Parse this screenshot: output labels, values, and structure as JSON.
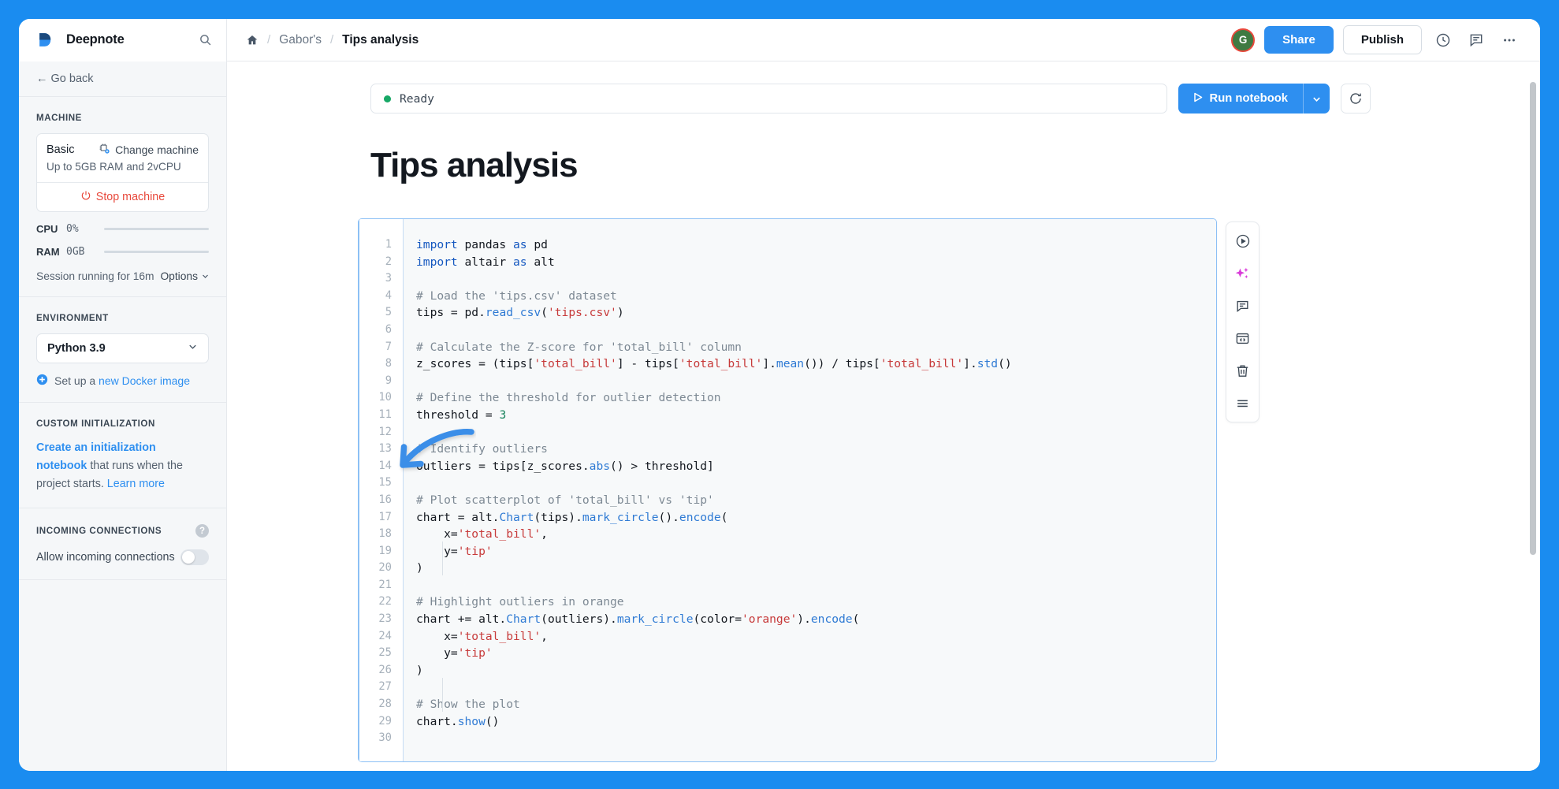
{
  "brand": {
    "name": "Deepnote",
    "logo_icon": "deepnote-logo",
    "search_icon": "search-icon"
  },
  "breadcrumb": {
    "home_icon": "home-icon",
    "sep": "/",
    "workspace": "Gabor's",
    "current": "Tips analysis"
  },
  "topbar_actions": {
    "avatar_initial": "G",
    "share_label": "Share",
    "publish_label": "Publish",
    "history_icon": "clock-history-icon",
    "comments_icon": "comment-icon",
    "more_icon": "more-horizontal-icon"
  },
  "sidebar": {
    "go_back": "← Go back",
    "machine": {
      "heading": "MACHINE",
      "name": "Basic",
      "change_label": "Change machine",
      "change_icon": "machine-chip-icon",
      "description": "Up to 5GB RAM and 2vCPU",
      "stop_label": "Stop machine",
      "stop_icon": "power-icon",
      "cpu_label": "CPU",
      "cpu_value": "0%",
      "ram_label": "RAM",
      "ram_value": "0GB",
      "session_text": "Session running for 16m",
      "options_label": "Options",
      "options_icon": "chevron-down-icon"
    },
    "environment": {
      "heading": "ENVIRONMENT",
      "selected": "Python 3.9",
      "chevron_icon": "chevron-down-icon",
      "docker_prefix": "Set up a ",
      "docker_link": "new Docker image",
      "plus_icon": "plus-circle-icon"
    },
    "custom_init": {
      "heading": "CUSTOM INITIALIZATION",
      "link_main": "Create an initialization notebook",
      "text_middle": " that runs when the project starts. ",
      "link_more": "Learn more"
    },
    "incoming": {
      "heading": "INCOMING CONNECTIONS",
      "help_icon": "help-circle-icon",
      "help_glyph": "?",
      "toggle_label": "Allow incoming connections",
      "toggle_state": "off"
    }
  },
  "main": {
    "status": {
      "text": "Ready",
      "dot_color": "#17a866"
    },
    "run": {
      "label": "Run notebook",
      "play_icon": "play-triangle-icon",
      "caret_icon": "chevron-down-icon",
      "refresh_icon": "refresh-icon"
    },
    "notebook_title": "Tips analysis",
    "cell": {
      "line_numbers": [
        "1",
        "2",
        "3",
        "4",
        "5",
        "6",
        "7",
        "8",
        "9",
        "10",
        "11",
        "12",
        "13",
        "14",
        "15",
        "16",
        "17",
        "18",
        "19",
        "20",
        "21",
        "22",
        "23",
        "24",
        "25",
        "26",
        "27",
        "28",
        "29",
        "30"
      ],
      "code": "import pandas as pd\nimport altair as alt\n\n# Load the 'tips.csv' dataset\ntips = pd.read_csv('tips.csv')\n\n# Calculate the Z-score for 'total_bill' column\nz_scores = (tips['total_bill'] - tips['total_bill'].mean()) / tips['total_bill'].std()\n\n# Define the threshold for outlier detection\nthreshold = 3\n\n# Identify outliers\noutliers = tips[z_scores.abs() > threshold]\n\n# Plot scatterplot of 'total_bill' vs 'tip'\nchart = alt.Chart(tips).mark_circle().encode(\n    x='total_bill',\n    y='tip'\n)\n\n# Highlight outliers in orange\nchart += alt.Chart(outliers).mark_circle(color='orange').encode(\n    x='total_bill',\n    y='tip'\n)\n\n# Show the plot\nchart.show()\n"
    },
    "cell_tools": [
      {
        "name": "run-cell-icon"
      },
      {
        "name": "ai-sparkles-icon"
      },
      {
        "name": "comment-icon"
      },
      {
        "name": "code-block-icon"
      },
      {
        "name": "delete-icon"
      },
      {
        "name": "drag-handle-icon"
      }
    ]
  },
  "colors": {
    "accent": "#2e8ff0",
    "page_bg": "#1a8cf0",
    "status_green": "#17a866",
    "danger_red": "#e8483b",
    "ai_magenta": "#d93bd9"
  }
}
